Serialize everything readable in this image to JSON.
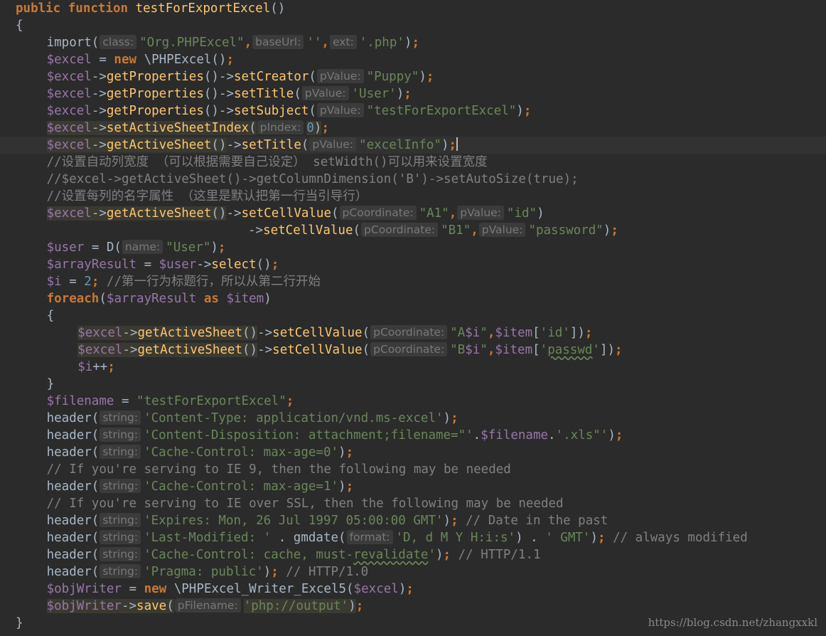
{
  "lines": [
    {
      "indent": 0,
      "tokens": [
        [
          "kw",
          "public function "
        ],
        [
          "fn",
          "testForExportExcel"
        ],
        [
          "pl",
          "()"
        ]
      ]
    },
    {
      "indent": 0,
      "tokens": [
        [
          "pl",
          "{"
        ]
      ]
    },
    {
      "indent": 4,
      "tokens": [
        [
          "pl",
          "import("
        ],
        [
          "hint",
          "class:"
        ],
        [
          "str",
          "\"Org.PHPExcel\""
        ],
        [
          "kw",
          ","
        ],
        [
          "hint",
          "baseUrl:"
        ],
        [
          "str",
          "''"
        ],
        [
          "kw",
          ","
        ],
        [
          "hint",
          "ext:"
        ],
        [
          "str",
          "'.php'"
        ],
        [
          "pl",
          ")"
        ],
        [
          "kw",
          ";"
        ]
      ]
    },
    {
      "indent": 4,
      "tokens": [
        [
          "var",
          "$excel"
        ],
        [
          "pl",
          " = "
        ],
        [
          "kw",
          "new "
        ],
        [
          "pl",
          "\\PHPExcel()"
        ],
        [
          "kw",
          ";"
        ]
      ]
    },
    {
      "indent": 4,
      "tokens": [
        [
          "var",
          "$excel"
        ],
        [
          "pl",
          "->"
        ],
        [
          "fn",
          "getProperties"
        ],
        [
          "pl",
          "()->"
        ],
        [
          "fn",
          "setCreator"
        ],
        [
          "pl",
          "("
        ],
        [
          "hint",
          "pValue:"
        ],
        [
          "str",
          "\"Puppy\""
        ],
        [
          "pl",
          ")"
        ],
        [
          "kw",
          ";"
        ]
      ]
    },
    {
      "indent": 4,
      "tokens": [
        [
          "var",
          "$excel"
        ],
        [
          "pl",
          "->"
        ],
        [
          "fn",
          "getProperties"
        ],
        [
          "pl",
          "()->"
        ],
        [
          "fn",
          "setTitle"
        ],
        [
          "pl",
          "("
        ],
        [
          "hint",
          "pValue:"
        ],
        [
          "str",
          "'User'"
        ],
        [
          "pl",
          ")"
        ],
        [
          "kw",
          ";"
        ]
      ]
    },
    {
      "indent": 4,
      "tokens": [
        [
          "var",
          "$excel"
        ],
        [
          "pl",
          "->"
        ],
        [
          "fn",
          "getProperties"
        ],
        [
          "pl",
          "()->"
        ],
        [
          "fn",
          "setSubject"
        ],
        [
          "pl",
          "("
        ],
        [
          "hint",
          "pValue:"
        ],
        [
          "str",
          "\"testForExportExcel\""
        ],
        [
          "pl",
          ")"
        ],
        [
          "kw",
          ";"
        ]
      ]
    },
    {
      "indent": 4,
      "tokens": [
        [
          "var hl",
          "$excel"
        ],
        [
          "pl hl",
          "->"
        ],
        [
          "fn hl",
          "setActiveSheetIndex"
        ],
        [
          "pl hl",
          "("
        ],
        [
          "hint",
          "pIndex:"
        ],
        [
          "num hl",
          "0"
        ],
        [
          "pl hl",
          ")"
        ],
        [
          "kw",
          ";"
        ]
      ]
    },
    {
      "indent": 4,
      "current": true,
      "tokens": [
        [
          "var hl",
          "$excel"
        ],
        [
          "pl hl",
          "->"
        ],
        [
          "fn hl",
          "getActiveSheet"
        ],
        [
          "pl hl",
          "()"
        ],
        [
          "pl",
          "->"
        ],
        [
          "fn",
          "setTitle"
        ],
        [
          "pl",
          "("
        ],
        [
          "hint",
          "pValue:"
        ],
        [
          "str",
          "\"excelInfo\""
        ],
        [
          "pl",
          ")"
        ],
        [
          "kw",
          ";"
        ],
        [
          "caret",
          ""
        ]
      ]
    },
    {
      "indent": 4,
      "tokens": [
        [
          "cmt",
          "//设置自动列宽度 （可以根据需要自己设定） setWidth()可以用来设置宽度"
        ]
      ]
    },
    {
      "indent": 4,
      "tokens": [
        [
          "cmt",
          "//$excel->getActiveSheet()->getColumnDimension('B')->setAutoSize(true);"
        ]
      ]
    },
    {
      "indent": 4,
      "tokens": [
        [
          "cmt",
          "//设置每列的名字属性 （这里是默认把第一行当引导行）"
        ]
      ]
    },
    {
      "indent": 4,
      "tokens": [
        [
          "var hl",
          "$excel"
        ],
        [
          "pl hl",
          "->"
        ],
        [
          "fn hl",
          "getActiveSheet"
        ],
        [
          "pl hl",
          "()"
        ],
        [
          "pl",
          "->"
        ],
        [
          "fn",
          "setCellValue"
        ],
        [
          "pl",
          "("
        ],
        [
          "hint",
          "pCoordinate:"
        ],
        [
          "str",
          "\"A1\""
        ],
        [
          "kw",
          ","
        ],
        [
          "hint",
          "pValue:"
        ],
        [
          "str",
          "\"id\""
        ],
        [
          "pl",
          ")"
        ]
      ]
    },
    {
      "indent": 30,
      "tokens": [
        [
          "pl",
          "->"
        ],
        [
          "fn",
          "setCellValue"
        ],
        [
          "pl",
          "("
        ],
        [
          "hint",
          "pCoordinate:"
        ],
        [
          "str",
          "\"B1\""
        ],
        [
          "kw",
          ","
        ],
        [
          "hint",
          "pValue:"
        ],
        [
          "str",
          "\"password\""
        ],
        [
          "pl",
          ")"
        ],
        [
          "kw",
          ";"
        ]
      ]
    },
    {
      "indent": 4,
      "tokens": [
        [
          "var",
          "$user"
        ],
        [
          "pl",
          " = D("
        ],
        [
          "hint",
          "name:"
        ],
        [
          "str",
          "\"User\""
        ],
        [
          "pl",
          ")"
        ],
        [
          "kw",
          ";"
        ]
      ]
    },
    {
      "indent": 4,
      "tokens": [
        [
          "var",
          "$arrayResult"
        ],
        [
          "pl",
          " = "
        ],
        [
          "var",
          "$user"
        ],
        [
          "pl",
          "->"
        ],
        [
          "fn",
          "select"
        ],
        [
          "pl",
          "()"
        ],
        [
          "kw",
          ";"
        ]
      ]
    },
    {
      "indent": 4,
      "tokens": [
        [
          "var",
          "$i"
        ],
        [
          "pl",
          " = "
        ],
        [
          "num",
          "2"
        ],
        [
          "kw",
          "; "
        ],
        [
          "cmt",
          "//第一行为标题行，所以从第二行开始"
        ]
      ]
    },
    {
      "indent": 4,
      "tokens": [
        [
          "kw",
          "foreach"
        ],
        [
          "pl",
          "("
        ],
        [
          "var",
          "$arrayResult"
        ],
        [
          "kw",
          " as "
        ],
        [
          "var",
          "$item"
        ],
        [
          "pl",
          ")"
        ]
      ]
    },
    {
      "indent": 4,
      "tokens": [
        [
          "pl",
          "{"
        ]
      ]
    },
    {
      "indent": 8,
      "tokens": [
        [
          "var hl",
          "$excel"
        ],
        [
          "pl hl",
          "->"
        ],
        [
          "fn hl",
          "getActiveSheet"
        ],
        [
          "pl hl",
          "()"
        ],
        [
          "pl",
          "->"
        ],
        [
          "fn",
          "setCellValue"
        ],
        [
          "pl",
          "("
        ],
        [
          "hint",
          "pCoordinate:"
        ],
        [
          "str",
          "\"A"
        ],
        [
          "var",
          "$i"
        ],
        [
          "str",
          "\""
        ],
        [
          "kw",
          ","
        ],
        [
          "var",
          "$item"
        ],
        [
          "pl",
          "["
        ],
        [
          "str",
          "'id'"
        ],
        [
          "pl",
          "])"
        ],
        [
          "kw",
          ";"
        ]
      ]
    },
    {
      "indent": 8,
      "tokens": [
        [
          "var hl",
          "$excel"
        ],
        [
          "pl hl",
          "->"
        ],
        [
          "fn hl",
          "getActiveSheet"
        ],
        [
          "pl hl",
          "()"
        ],
        [
          "pl",
          "->"
        ],
        [
          "fn",
          "setCellValue"
        ],
        [
          "pl",
          "("
        ],
        [
          "hint",
          "pCoordinate:"
        ],
        [
          "str",
          "\"B"
        ],
        [
          "var",
          "$i"
        ],
        [
          "str",
          "\""
        ],
        [
          "kw",
          ","
        ],
        [
          "var",
          "$item"
        ],
        [
          "pl",
          "["
        ],
        [
          "str",
          "'"
        ],
        [
          "str typo",
          "passwd"
        ],
        [
          "str",
          "'"
        ],
        [
          "pl",
          "])"
        ],
        [
          "kw",
          ";"
        ]
      ]
    },
    {
      "indent": 8,
      "tokens": [
        [
          "var",
          "$i"
        ],
        [
          "pl",
          "++"
        ],
        [
          "kw",
          ";"
        ]
      ]
    },
    {
      "indent": 4,
      "tokens": [
        [
          "pl",
          "}"
        ]
      ]
    },
    {
      "indent": 4,
      "tokens": [
        [
          "var",
          "$filename"
        ],
        [
          "pl",
          " = "
        ],
        [
          "str",
          "\"testForExportExcel\""
        ],
        [
          "kw",
          ";"
        ]
      ]
    },
    {
      "indent": 4,
      "tokens": [
        [
          "pl",
          "header("
        ],
        [
          "hint",
          "string:"
        ],
        [
          "str",
          "'Content-Type: application/vnd.ms-excel'"
        ],
        [
          "pl",
          ")"
        ],
        [
          "kw",
          ";"
        ]
      ]
    },
    {
      "indent": 4,
      "tokens": [
        [
          "pl",
          "header("
        ],
        [
          "hint",
          "string:"
        ],
        [
          "str",
          "'Content-Disposition: attachment;filename=\"'"
        ],
        [
          "pl",
          "."
        ],
        [
          "var",
          "$filename"
        ],
        [
          "pl",
          "."
        ],
        [
          "str",
          "'.xls\"'"
        ],
        [
          "pl",
          ")"
        ],
        [
          "kw",
          ";"
        ]
      ]
    },
    {
      "indent": 4,
      "tokens": [
        [
          "pl",
          "header("
        ],
        [
          "hint",
          "string:"
        ],
        [
          "str",
          "'Cache-Control: max-age=0'"
        ],
        [
          "pl",
          ")"
        ],
        [
          "kw",
          ";"
        ]
      ]
    },
    {
      "indent": 4,
      "tokens": [
        [
          "cmt",
          "// If you're serving to IE 9, then the following may be needed"
        ]
      ]
    },
    {
      "indent": 4,
      "tokens": [
        [
          "pl",
          "header("
        ],
        [
          "hint",
          "string:"
        ],
        [
          "str",
          "'Cache-Control: max-age=1'"
        ],
        [
          "pl",
          ")"
        ],
        [
          "kw",
          ";"
        ]
      ]
    },
    {
      "indent": 4,
      "tokens": [
        [
          "cmt",
          "// If you're serving to IE over SSL, then the following may be needed"
        ]
      ]
    },
    {
      "indent": 4,
      "tokens": [
        [
          "pl",
          "header("
        ],
        [
          "hint",
          "string:"
        ],
        [
          "str",
          "'Expires: Mon, 26 Jul 1997 05:00:00 GMT'"
        ],
        [
          "pl",
          ")"
        ],
        [
          "kw",
          "; "
        ],
        [
          "cmt",
          "// Date in the past"
        ]
      ]
    },
    {
      "indent": 4,
      "tokens": [
        [
          "pl",
          "header("
        ],
        [
          "hint",
          "string:"
        ],
        [
          "str",
          "'Last-Modified: '"
        ],
        [
          "pl",
          " . gmdate("
        ],
        [
          "hint",
          "format:"
        ],
        [
          "str",
          "'D, d M Y H:i:s'"
        ],
        [
          "pl",
          ") . "
        ],
        [
          "str",
          "' GMT'"
        ],
        [
          "pl",
          ")"
        ],
        [
          "kw",
          "; "
        ],
        [
          "cmt",
          "// always modified"
        ]
      ]
    },
    {
      "indent": 4,
      "tokens": [
        [
          "pl",
          "header("
        ],
        [
          "hint",
          "string:"
        ],
        [
          "str",
          "'Cache-Control: cache, must-"
        ],
        [
          "str typo",
          "revalidate"
        ],
        [
          "str",
          "'"
        ],
        [
          "pl",
          ")"
        ],
        [
          "kw",
          "; "
        ],
        [
          "cmt",
          "// HTTP/1.1"
        ]
      ]
    },
    {
      "indent": 4,
      "tokens": [
        [
          "pl",
          "header("
        ],
        [
          "hint",
          "string:"
        ],
        [
          "str",
          "'Pragma: public'"
        ],
        [
          "pl",
          ")"
        ],
        [
          "kw",
          "; "
        ],
        [
          "cmt",
          "// HTTP/1.0"
        ]
      ]
    },
    {
      "indent": 4,
      "tokens": [
        [
          "var",
          "$objWriter"
        ],
        [
          "pl",
          " = "
        ],
        [
          "kw",
          "new "
        ],
        [
          "pl",
          "\\PHPExcel_Writer_Excel5("
        ],
        [
          "var",
          "$excel"
        ],
        [
          "pl",
          ")"
        ],
        [
          "kw",
          ";"
        ]
      ]
    },
    {
      "indent": 4,
      "tokens": [
        [
          "var hl",
          "$objWriter"
        ],
        [
          "pl hl",
          "->"
        ],
        [
          "fn hl",
          "save"
        ],
        [
          "pl hl",
          "("
        ],
        [
          "hint",
          "pFilename:"
        ],
        [
          "str hl",
          "'php://output'"
        ],
        [
          "pl hl",
          ")"
        ],
        [
          "kw",
          ";"
        ]
      ]
    },
    {
      "indent": 0,
      "tokens": [
        [
          "pl",
          "}"
        ]
      ]
    }
  ],
  "watermark": "https://blog.csdn.net/zhangxxkl"
}
